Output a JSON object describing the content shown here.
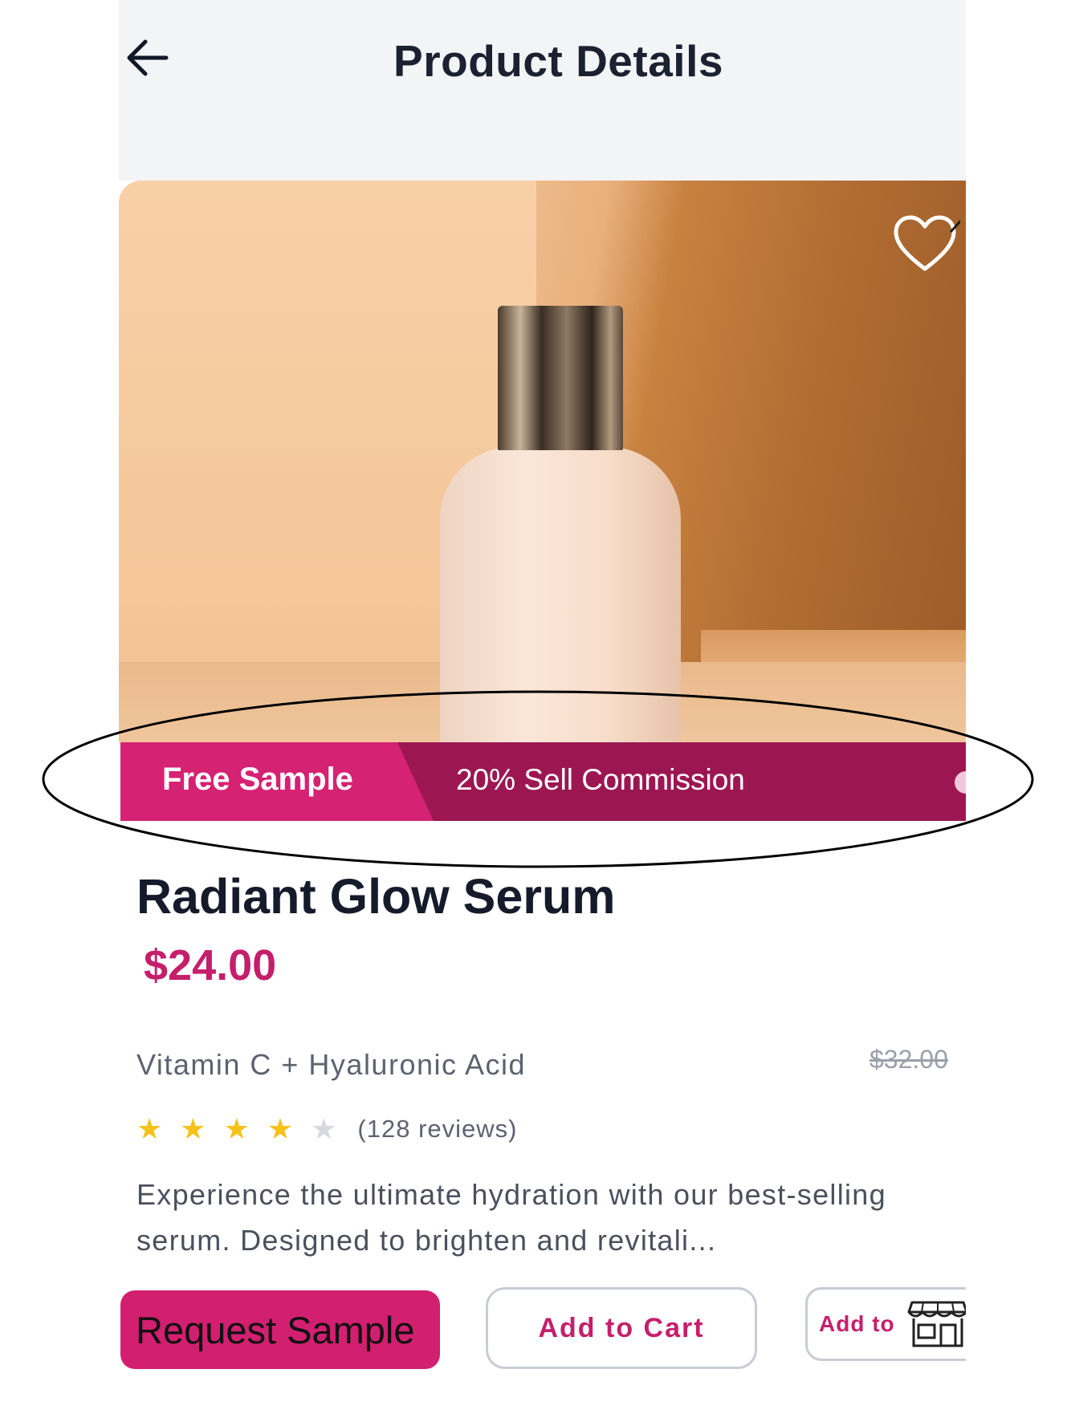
{
  "header": {
    "title": "Product Details",
    "back_icon": "arrow-left-icon"
  },
  "hero": {
    "favorite_icon": "heart-outline-icon"
  },
  "promo": {
    "free_sample_label": "Free Sample",
    "commission_label": "20% Sell Commission"
  },
  "product": {
    "name": "Radiant Glow Serum",
    "price": "$24.00",
    "original_price": "$32.00",
    "subtitle": "Vitamin C + Hyaluronic Acid",
    "rating": 4,
    "rating_max": 5,
    "reviews_label": "(128 reviews)",
    "description": "Experience the ultimate hydration with our best-selling serum. Designed to brighten and revitali..."
  },
  "actions": {
    "request_sample_label": "Request Sample",
    "add_to_cart_label": "Add to Cart",
    "add_to_store_label": "Add to",
    "store_icon": "storefront-icon"
  },
  "colors": {
    "accent": "#c51f6b",
    "promo_light": "#d52272",
    "promo_dark": "#9c1752",
    "star": "#f4c21b"
  }
}
